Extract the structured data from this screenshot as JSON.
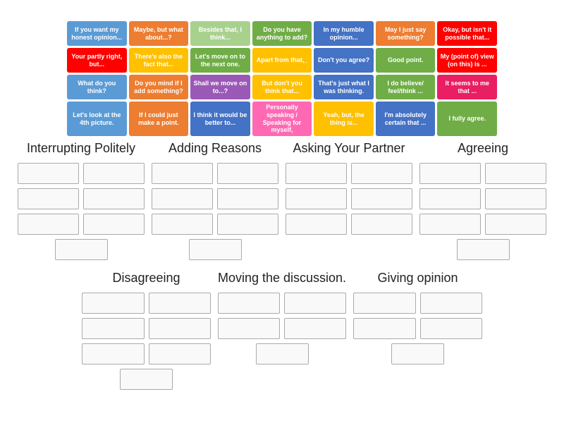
{
  "tiles": [
    [
      {
        "text": "If you want my honest opinion...",
        "color": "#5b9bd5"
      },
      {
        "text": "Maybe, but what about...?",
        "color": "#ed7d31"
      },
      {
        "text": "Besides that, I think...",
        "color": "#a9d18e"
      },
      {
        "text": "Do you have anything to add?",
        "color": "#70ad47"
      },
      {
        "text": "In my humble opinion...",
        "color": "#4472c4"
      },
      {
        "text": "May I just say something?",
        "color": "#ed7d31"
      },
      {
        "text": "Okay, but isn't it possible that...",
        "color": "#ff0000"
      }
    ],
    [
      {
        "text": "Your partly right, but...",
        "color": "#ff0000"
      },
      {
        "text": "There's also the fact that...",
        "color": "#ffc000"
      },
      {
        "text": "Let's move on to the next one.",
        "color": "#70ad47"
      },
      {
        "text": "Apart from that,_",
        "color": "#ffc000"
      },
      {
        "text": "Don't you agree?",
        "color": "#4472c4"
      },
      {
        "text": "Good point.",
        "color": "#70ad47"
      },
      {
        "text": "My (point of) view (on this) is ...",
        "color": "#ff0000"
      }
    ],
    [
      {
        "text": "What do you think?",
        "color": "#5b9bd5"
      },
      {
        "text": "Do you mind if I add something?",
        "color": "#ed7d31"
      },
      {
        "text": "Shall we move on to...?",
        "color": "#9b59b6"
      },
      {
        "text": "But don't you think that...",
        "color": "#ffc000"
      },
      {
        "text": "That's just what I was thinking.",
        "color": "#4472c4"
      },
      {
        "text": "I do believe/ feel/think ...",
        "color": "#70ad47"
      },
      {
        "text": "It seems to me that ...",
        "color": "#e91e63"
      }
    ],
    [
      {
        "text": "Let's look at the 4th picture.",
        "color": "#5b9bd5"
      },
      {
        "text": "If I could just make a point.",
        "color": "#ed7d31"
      },
      {
        "text": "I think it would be better to...",
        "color": "#4472c4"
      },
      {
        "text": "Personally speaking / Speaking for myself,",
        "color": "#ff69b4"
      },
      {
        "text": "Yeah, but, the thing is...",
        "color": "#ffc000"
      },
      {
        "text": "I'm absolutely certain that ...",
        "color": "#4472c4"
      },
      {
        "text": "I fully agree.",
        "color": "#70ad47"
      }
    ]
  ],
  "categories": {
    "top": [
      {
        "title": "Interrupting Politely",
        "boxes": 5,
        "extra": 1
      },
      {
        "title": "Adding Reasons",
        "boxes": 6,
        "extra": 1
      },
      {
        "title": "Asking Your Partner",
        "boxes": 4,
        "extra": 0
      },
      {
        "title": "Agreeing",
        "boxes": 4,
        "extra": 1
      }
    ],
    "bottom": [
      {
        "title": "Disagreeing",
        "boxes": 6,
        "extra": 1
      },
      {
        "title": "Moving the discussion.",
        "boxes": 4,
        "extra": 1
      },
      {
        "title": "Giving opinion",
        "boxes": 4,
        "extra": 1
      }
    ]
  }
}
